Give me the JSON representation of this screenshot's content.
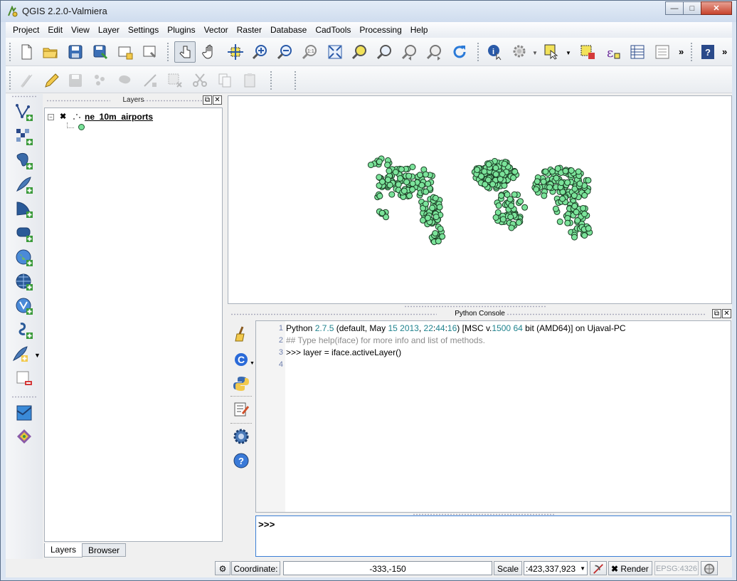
{
  "window": {
    "title": "QGIS 2.2.0-Valmiera"
  },
  "menu": [
    "Project",
    "Edit",
    "View",
    "Layer",
    "Settings",
    "Plugins",
    "Vector",
    "Raster",
    "Database",
    "CadTools",
    "Processing",
    "Help"
  ],
  "layers_panel": {
    "title": "Layers",
    "layers": [
      {
        "name": "ne_10m_airports",
        "visible": true
      }
    ],
    "tabs": [
      "Layers",
      "Browser"
    ],
    "active_tab": "Layers"
  },
  "console": {
    "title": "Python Console",
    "lines": [
      {
        "n": "1",
        "parts": [
          "Python ",
          "2.7.5",
          " (default, May ",
          "15",
          " ",
          "2013",
          ", ",
          "22",
          ":",
          "44",
          ":",
          "16",
          ") [MSC v.",
          "1500",
          " ",
          "64",
          " bit (AMD64)] on Ujaval-PC"
        ]
      },
      {
        "n": "2",
        "text": "## Type help(iface) for more info and list of methods."
      },
      {
        "n": "3",
        "text": ">>> layer = iface.activeLayer()"
      },
      {
        "n": "4",
        "text": ""
      }
    ],
    "prompt": ">>>"
  },
  "statusbar": {
    "coordinate_label": "Coordinate:",
    "coordinate_value": "-333,-150",
    "scale_label": "Scale",
    "scale_value": ":423,337,923",
    "render_label": "Render",
    "render_checked": true,
    "crs": "EPSG:4326"
  },
  "colors": {
    "point_fill": "#7be39a",
    "point_stroke": "#1a3d24",
    "accent": "#3c7fd6"
  }
}
